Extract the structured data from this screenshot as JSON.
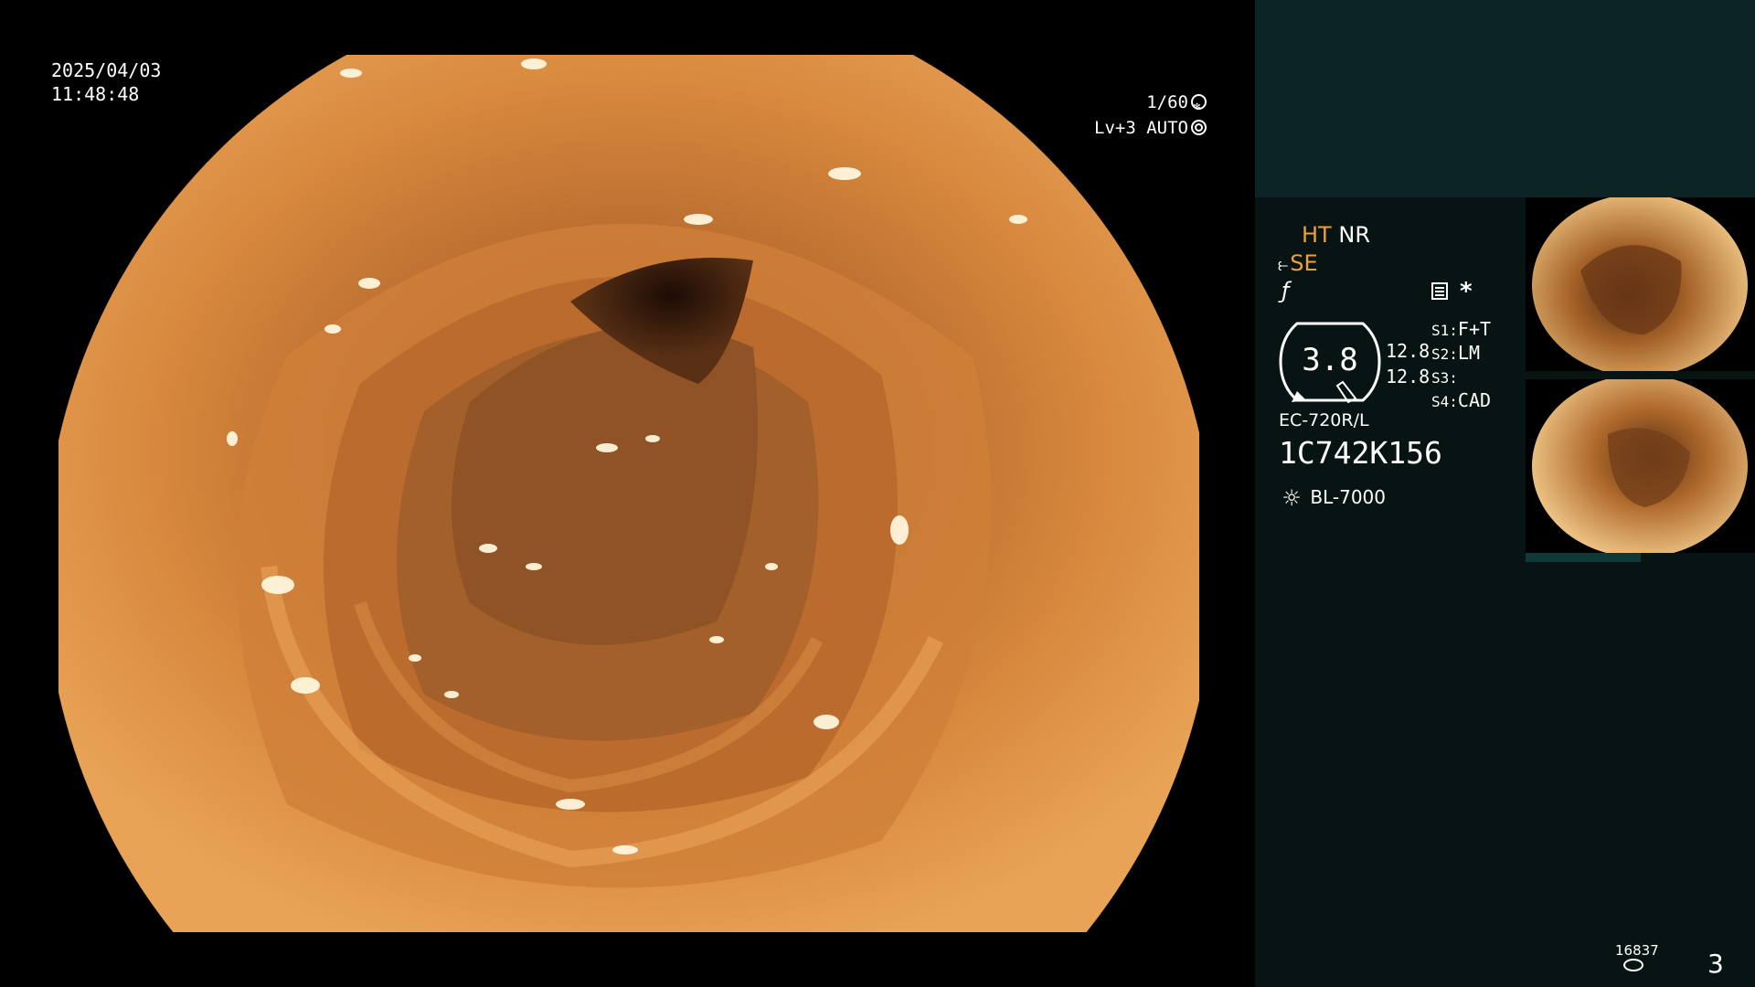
{
  "overlay": {
    "date": "2025/04/03",
    "time": "11:48:48",
    "shutter_speed": "1/60",
    "exposure": "Lv+3 AUTO"
  },
  "status": {
    "ht": "HT",
    "nr": "NR",
    "se": "SE",
    "gauge_value": "3.8",
    "ratio_top": "12.8",
    "ratio_bottom": "12.8",
    "slots": [
      {
        "key": "S1:",
        "value": "F+T"
      },
      {
        "key": "S2:",
        "value": "LM"
      },
      {
        "key": "S3:",
        "value": ""
      },
      {
        "key": "S4:",
        "value": "CAD"
      }
    ],
    "scope_model": "EC-720R/L",
    "serial": "1C742K156",
    "light_source": "BL-7000",
    "counter": "16837",
    "page_number": "3"
  },
  "colors": {
    "accent": "#f0a131",
    "panel_top": "#0b2426",
    "panel": "#081414"
  }
}
